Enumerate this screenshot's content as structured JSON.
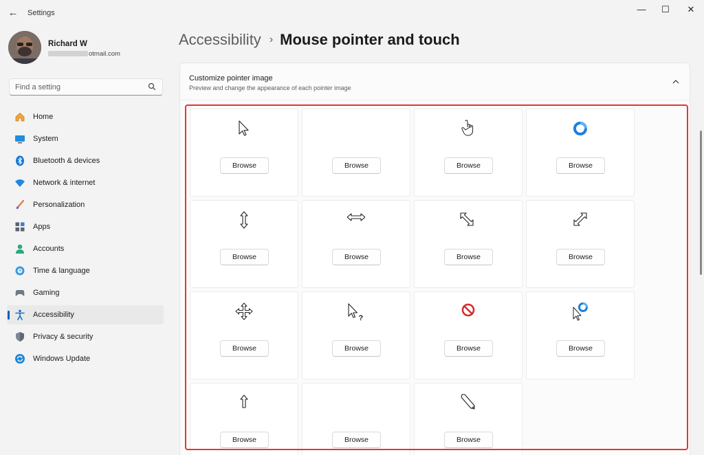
{
  "window": {
    "title": "Settings",
    "controls": {
      "minimize": "—",
      "maximize": "☐",
      "close": "✕"
    }
  },
  "profile": {
    "name": "Richard W",
    "email_suffix": "otmail.com"
  },
  "search": {
    "placeholder": "Find a setting"
  },
  "sidebar": {
    "items": [
      {
        "label": "Home",
        "icon": "home-icon"
      },
      {
        "label": "System",
        "icon": "system-icon"
      },
      {
        "label": "Bluetooth & devices",
        "icon": "bluetooth-icon"
      },
      {
        "label": "Network & internet",
        "icon": "wifi-icon"
      },
      {
        "label": "Personalization",
        "icon": "brush-icon"
      },
      {
        "label": "Apps",
        "icon": "apps-icon"
      },
      {
        "label": "Accounts",
        "icon": "accounts-icon"
      },
      {
        "label": "Time & language",
        "icon": "clock-globe-icon"
      },
      {
        "label": "Gaming",
        "icon": "gamepad-icon"
      },
      {
        "label": "Accessibility",
        "icon": "accessibility-icon",
        "active": true
      },
      {
        "label": "Privacy & security",
        "icon": "shield-icon"
      },
      {
        "label": "Windows Update",
        "icon": "update-icon"
      }
    ]
  },
  "header": {
    "parent": "Accessibility",
    "separator": "›",
    "current": "Mouse pointer and touch"
  },
  "section": {
    "title": "Customize pointer image",
    "subtitle": "Preview and change the appearance of each pointer image",
    "browse_label": "Browse",
    "pointers": [
      {
        "icon": "normal-select-cursor-icon"
      },
      {
        "icon": "blank-cursor-icon"
      },
      {
        "icon": "link-select-hand-cursor-icon"
      },
      {
        "icon": "busy-spinner-cursor-icon"
      },
      {
        "icon": "vertical-resize-cursor-icon"
      },
      {
        "icon": "horizontal-resize-cursor-icon"
      },
      {
        "icon": "diagonal-resize-1-cursor-icon"
      },
      {
        "icon": "diagonal-resize-2-cursor-icon"
      },
      {
        "icon": "move-cursor-icon"
      },
      {
        "icon": "help-select-cursor-icon"
      },
      {
        "icon": "unavailable-cursor-icon"
      },
      {
        "icon": "working-in-background-cursor-icon"
      },
      {
        "icon": "alternate-select-cursor-icon"
      },
      {
        "icon": "blank-cursor-icon"
      },
      {
        "icon": "handwriting-pen-cursor-icon"
      }
    ]
  },
  "colors": {
    "accent": "#005fb8",
    "highlight_border": "#e53535",
    "spinner": "#1a7fe0",
    "unavailable": "#d32f2f"
  }
}
